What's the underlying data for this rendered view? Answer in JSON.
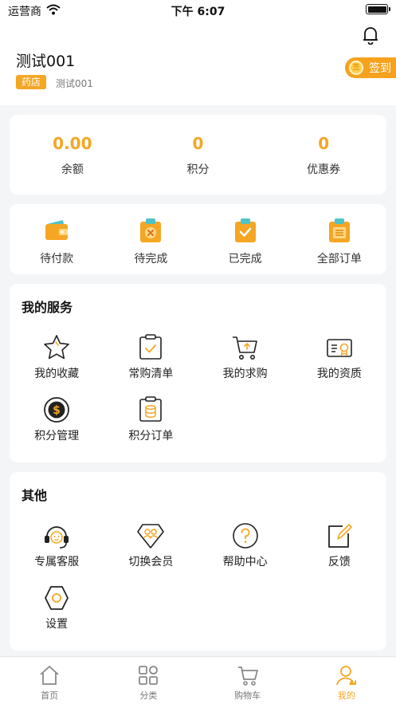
{
  "status": {
    "carrier": "运营商",
    "time": "下午 6:07"
  },
  "profile": {
    "name": "测试001",
    "badge": "药店",
    "store": "测试001",
    "checkin_label": "签到",
    "checkin_icon_text": "签"
  },
  "stats": [
    {
      "value": "0.00",
      "label": "余额"
    },
    {
      "value": "0",
      "label": "积分"
    },
    {
      "value": "0",
      "label": "优惠券"
    }
  ],
  "orders": [
    {
      "label": "待付款",
      "icon": "wallet-icon"
    },
    {
      "label": "待完成",
      "icon": "clipboard-x-icon"
    },
    {
      "label": "已完成",
      "icon": "clipboard-check-icon"
    },
    {
      "label": "全部订单",
      "icon": "clipboard-list-icon"
    }
  ],
  "services": {
    "title": "我的服务",
    "items": [
      {
        "label": "我的收藏",
        "icon": "star-icon"
      },
      {
        "label": "常购清单",
        "icon": "checklist-icon"
      },
      {
        "label": "我的求购",
        "icon": "cart-upload-icon"
      },
      {
        "label": "我的资质",
        "icon": "certificate-icon"
      },
      {
        "label": "积分管理",
        "icon": "coin-icon"
      },
      {
        "label": "积分订单",
        "icon": "points-order-icon"
      }
    ]
  },
  "others": {
    "title": "其他",
    "items": [
      {
        "label": "专属客服",
        "icon": "headset-icon"
      },
      {
        "label": "切换会员",
        "icon": "switch-member-icon"
      },
      {
        "label": "帮助中心",
        "icon": "help-icon"
      },
      {
        "label": "反馈",
        "icon": "feedback-icon"
      },
      {
        "label": "设置",
        "icon": "settings-icon"
      }
    ]
  },
  "tabs": [
    {
      "label": "首页",
      "icon": "home-icon",
      "active": false
    },
    {
      "label": "分类",
      "icon": "category-icon",
      "active": false
    },
    {
      "label": "购物车",
      "icon": "cart-icon",
      "active": false
    },
    {
      "label": "我的",
      "icon": "profile-icon",
      "active": true
    }
  ],
  "colors": {
    "accent": "#f5a623",
    "background": "#f4f5f7",
    "text": "#222222"
  }
}
